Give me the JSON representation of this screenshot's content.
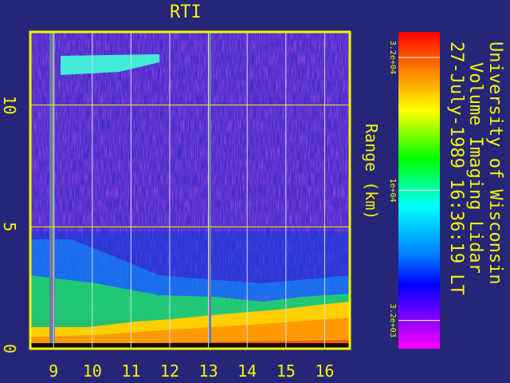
{
  "chart_data": {
    "type": "heatmap",
    "title": "RTI",
    "ylabel": "Range (km)",
    "xlabel": "",
    "x_ticks": [
      9,
      10,
      11,
      12,
      13,
      14,
      15,
      16
    ],
    "y_ticks": [
      0,
      5,
      10
    ],
    "xlim": [
      8.4,
      16.65
    ],
    "ylim": [
      0,
      13
    ],
    "grid": true,
    "colorbar": {
      "scale": "log",
      "range": [
        2500,
        40000
      ],
      "tick_values": [
        3200,
        10000,
        32000
      ],
      "tick_labels": [
        "3.2e+03",
        "1e+04",
        "3.2e+04"
      ]
    },
    "annotations": [
      "University of Wisconsin",
      "Volume Imaging Lidar",
      "27-July-1989 16:36:19 LT"
    ],
    "features": {
      "boundary_layer_top_km": [
        [
          8.5,
          0.6
        ],
        [
          10,
          0.9
        ],
        [
          12,
          1.2
        ],
        [
          13,
          1.4
        ],
        [
          14,
          1.5
        ],
        [
          15,
          1.7
        ],
        [
          16.5,
          2.0
        ]
      ],
      "elevated_layer_km": [
        12.2,
        13.0
      ],
      "elevated_layer_time": [
        8.7,
        12.0
      ],
      "mid_layer_km": 5.0,
      "data_gaps_time": [
        8.55,
        12.9
      ]
    }
  }
}
